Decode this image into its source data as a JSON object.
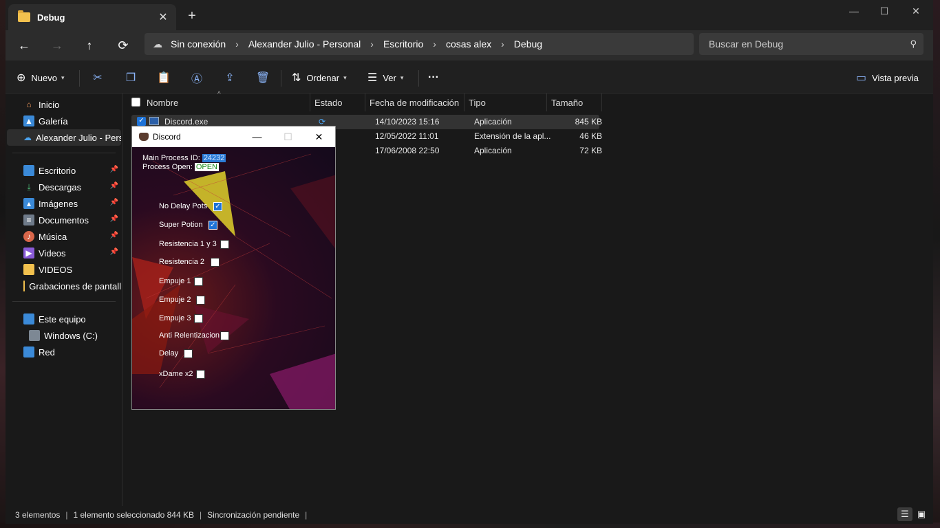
{
  "tab": {
    "title": "Debug",
    "close": "✕",
    "new": "+"
  },
  "window_controls": {
    "minimize": "—",
    "maximize": "☐",
    "close": "✕"
  },
  "nav": {
    "back": "←",
    "forward": "→",
    "up": "↑",
    "refresh": "⟳"
  },
  "address": {
    "status": "Sin conexión",
    "crumbs": [
      "Alexander Julio - Personal",
      "Escritorio",
      "cosas alex",
      "Debug"
    ],
    "sep": "›"
  },
  "search": {
    "placeholder": "Buscar en Debug",
    "icon": "search-icon"
  },
  "commands": {
    "new_label": "Nuevo",
    "sort_label": "Ordenar",
    "view_label": "Ver",
    "more": "···",
    "preview_label": "Vista previa"
  },
  "sidebar": {
    "items": [
      {
        "label": "Inicio",
        "icon": "home-icon"
      },
      {
        "label": "Galería",
        "icon": "gallery-icon"
      },
      {
        "label": "Alexander Julio - Perso",
        "icon": "onedrive-cloud-icon"
      },
      {
        "label": "Escritorio",
        "icon": "desktop-icon"
      },
      {
        "label": "Descargas",
        "icon": "download-icon"
      },
      {
        "label": "Imágenes",
        "icon": "pictures-icon"
      },
      {
        "label": "Documentos",
        "icon": "documents-icon"
      },
      {
        "label": "Música",
        "icon": "music-icon"
      },
      {
        "label": "Videos",
        "icon": "videos-icon"
      },
      {
        "label": "VIDEOS",
        "icon": "folder-icon"
      },
      {
        "label": "Grabaciones de pantall",
        "icon": "folder-icon"
      },
      {
        "label": "Este equipo",
        "icon": "pc-icon"
      },
      {
        "label": "Windows (C:)",
        "icon": "drive-icon"
      },
      {
        "label": "Red",
        "icon": "network-icon"
      }
    ]
  },
  "columns": [
    "Nombre",
    "Estado",
    "Fecha de modificación",
    "Tipo",
    "Tamaño"
  ],
  "files": [
    {
      "name": "Discord.exe",
      "date": "14/10/2023 15:16",
      "type": "Aplicación",
      "size": "845 KB",
      "selected": true
    },
    {
      "name": "",
      "date": "12/05/2022 11:01",
      "type": "Extensión de la apl...",
      "size": "46 KB",
      "selected": false
    },
    {
      "name": "",
      "date": "17/06/2008 22:50",
      "type": "Aplicación",
      "size": "72 KB",
      "selected": false
    }
  ],
  "status": {
    "count": "3 elementos",
    "selected": "1 elemento seleccionado  844 KB",
    "sync": "Sincronización pendiente"
  },
  "discord": {
    "title": "Discord",
    "pid_label": "Main Process ID:",
    "pid_value": "24232",
    "open_label": "Process Open:",
    "open_value": "OPEN",
    "options": [
      {
        "label": "No Delay Pots",
        "checked": true
      },
      {
        "label": "Super Potion",
        "checked": true
      },
      {
        "label": "Resistencia 1 y 3",
        "checked": false
      },
      {
        "label": "Resistencia 2",
        "checked": false
      },
      {
        "label": "Empuje 1",
        "checked": false
      },
      {
        "label": "Empuje 2",
        "checked": false
      },
      {
        "label": "Empuje 3",
        "checked": false
      },
      {
        "label": "Anti Relentizacion",
        "checked": false
      },
      {
        "label": "Delay",
        "checked": false
      },
      {
        "label": "xDame x2",
        "checked": false
      }
    ]
  },
  "colors": {
    "accent": "#1e73d8",
    "folder": "#f2c14e",
    "bg": "#191919"
  }
}
